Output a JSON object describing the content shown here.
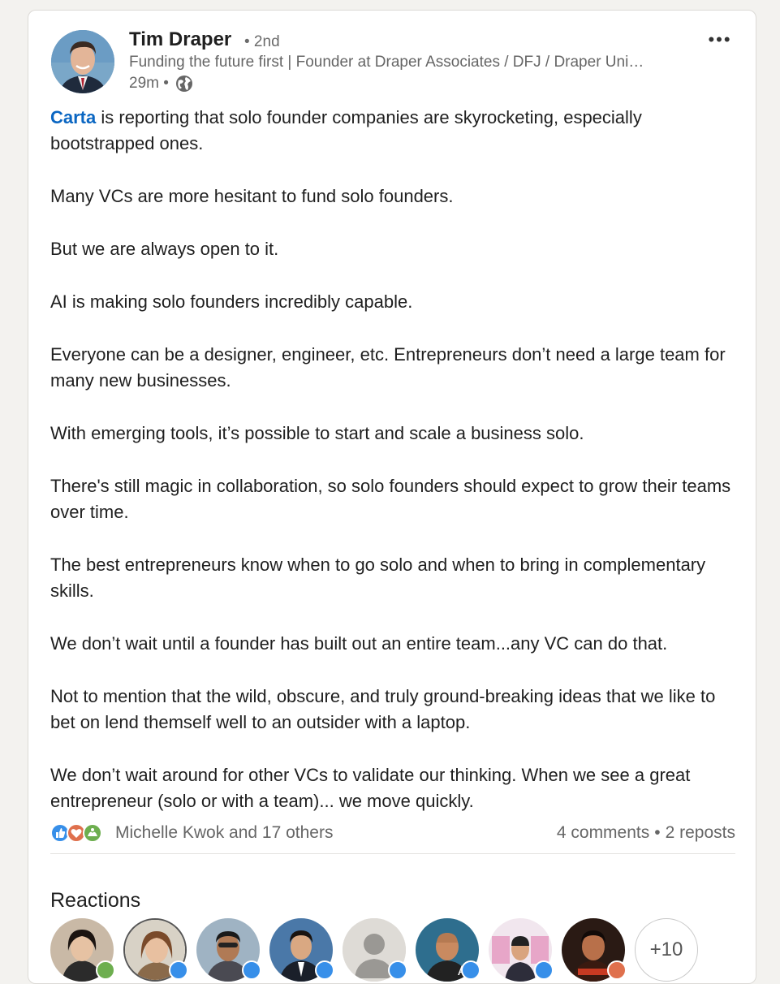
{
  "author": {
    "name": "Tim Draper",
    "degree": "• 2nd",
    "headline": "Funding the future first | Founder at Draper Associates / DFJ / Draper Uni…",
    "time": "29m •",
    "visibility_icon": "globe-icon"
  },
  "more_icon": "more-options-icon",
  "post": {
    "mention": "Carta",
    "paragraphs": [
      " is reporting that solo founder companies are skyrocketing, especially bootstrapped ones.",
      "Many VCs are more hesitant to fund solo founders.",
      "But we are always open to it.",
      "AI is making solo founders incredibly capable.",
      "Everyone can be a designer, engineer, etc. Entrepreneurs don’t need a large team for many new businesses.",
      "With emerging tools, it’s possible to start and scale a business solo.",
      "There's still magic in collaboration, so solo founders should expect to grow their teams over time.",
      "The best entrepreneurs know when to go solo and when to bring in complementary skills.",
      "We don’t wait until a founder has built out an entire team...any VC can do that.",
      "Not to mention that the wild, obscure, and truly ground-breaking ideas that we like to bet on lend themself well to an outsider with a laptop.",
      "We don’t wait around for other VCs to validate our thinking. When we see a great entrepreneur (solo or with a team)... we move quickly."
    ]
  },
  "social": {
    "reactors": "Michelle Kwok and 17 others",
    "comments": "4 comments",
    "separator": "•",
    "reposts": "2 reposts",
    "reaction_icons": [
      "like-icon",
      "love-icon",
      "support-icon"
    ]
  },
  "reactions": {
    "title": "Reactions",
    "more": "+10"
  },
  "colors": {
    "link": "#0a66c2",
    "like": "#378fe9",
    "love": "#df704d",
    "support": "#6dae4f"
  }
}
